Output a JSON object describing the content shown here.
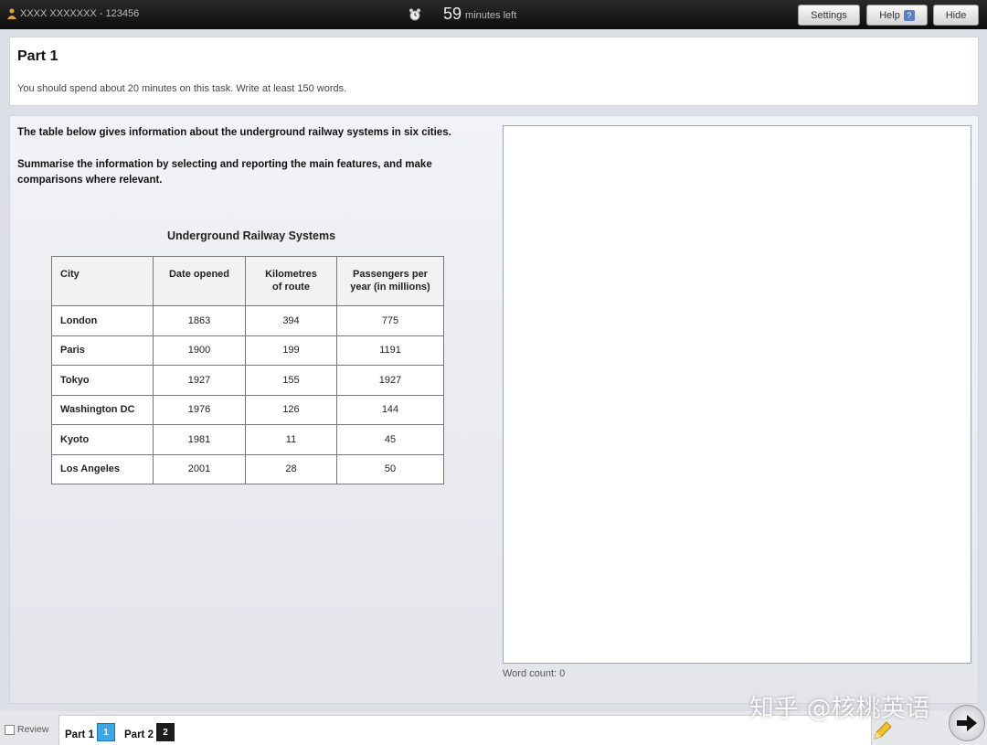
{
  "topbar": {
    "candidate_label": "XXXX XXXXXXX - 123456",
    "timer_value": "59",
    "timer_label": "minutes left",
    "settings_label": "Settings",
    "help_label": "Help",
    "help_badge": "?",
    "hide_label": "Hide"
  },
  "header": {
    "title": "Part 1",
    "instruction": "You should spend about 20 minutes on this task. Write at least 150 words."
  },
  "prompt": {
    "line1": "The table below gives information about the underground railway systems in six cities.",
    "line2": "Summarise the information by selecting and reporting the main features, and make comparisons where relevant."
  },
  "table": {
    "title": "Underground Railway Systems",
    "headers": [
      "City",
      "Date opened",
      "Kilometres of route",
      "Passengers per year (in millions)"
    ],
    "rows": [
      [
        "London",
        "1863",
        "394",
        "775"
      ],
      [
        "Paris",
        "1900",
        "199",
        "1191"
      ],
      [
        "Tokyo",
        "1927",
        "155",
        "1927"
      ],
      [
        "Washington DC",
        "1976",
        "126",
        "144"
      ],
      [
        "Kyoto",
        "1981",
        "11",
        "45"
      ],
      [
        "Los Angeles",
        "2001",
        "28",
        "50"
      ]
    ]
  },
  "answer": {
    "word_count_label": "Word count: 0"
  },
  "bottombar": {
    "review_label": "Review",
    "part1_label": "Part 1",
    "part1_badge": "1",
    "part2_label": "Part 2",
    "part2_badge": "2"
  },
  "watermark": "知乎 @核桃英语",
  "colors": {
    "active_badge": "#3ca7e0",
    "topbar": "#1a1a1a"
  }
}
